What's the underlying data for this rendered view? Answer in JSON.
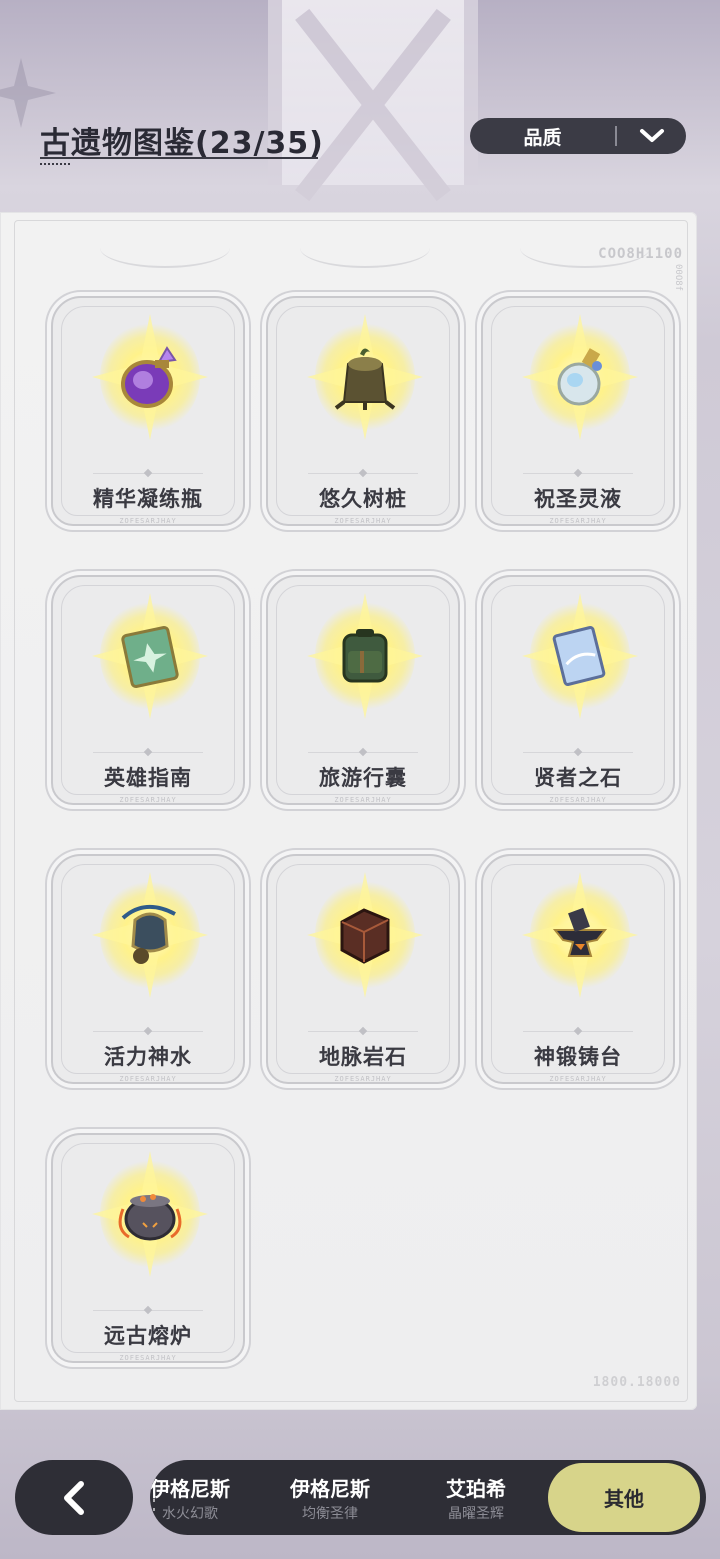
{
  "header": {
    "title": "古遗物图鉴(23/35)",
    "sort_label": "品质",
    "sort_icon": "chevron-down-icon"
  },
  "panel": {
    "code_top": "COO8H1100",
    "code_side": "00O8f",
    "code_bottom": "1800.18000"
  },
  "relics": [
    {
      "name": "精华凝练瓶",
      "icon": "purple-flask-icon",
      "code": "ZOFESARJHAY"
    },
    {
      "name": "悠久树桩",
      "icon": "tree-stump-icon",
      "code": "ZOFESARJHAY"
    },
    {
      "name": "祝圣灵液",
      "icon": "potion-bottle-icon",
      "code": "ZOFESARJHAY"
    },
    {
      "name": "英雄指南",
      "icon": "green-book-icon",
      "code": "ZOFESARJHAY"
    },
    {
      "name": "旅游行囊",
      "icon": "backpack-icon",
      "code": "ZOFESARJHAY"
    },
    {
      "name": "贤者之石",
      "icon": "crystal-tablet-icon",
      "code": "ZOFESARJHAY"
    },
    {
      "name": "活力神水",
      "icon": "vitality-urn-icon",
      "code": "ZOFESARJHAY"
    },
    {
      "name": "地脉岩石",
      "icon": "rock-cube-icon",
      "code": "ZOFESARJHAY"
    },
    {
      "name": "神锻铸台",
      "icon": "anvil-icon",
      "code": "ZOFESARJHAY"
    },
    {
      "name": "远古熔炉",
      "icon": "cauldron-icon",
      "code": "ZOFESARJHAY"
    }
  ],
  "bottom_nav": {
    "back_icon": "back-arrow-icon",
    "tabs": [
      {
        "title": "伊格尼斯",
        "subtitle": "水火幻歌"
      },
      {
        "title": "伊格尼斯",
        "subtitle": "均衡圣律"
      },
      {
        "title": "艾珀希",
        "subtitle": "晶曜圣辉"
      }
    ],
    "active_tab": "其他"
  },
  "colors": {
    "accent_active_tab": "#d7d48a",
    "nav_dark": "#2e2e36",
    "glow_yellow": "#fff28a"
  }
}
